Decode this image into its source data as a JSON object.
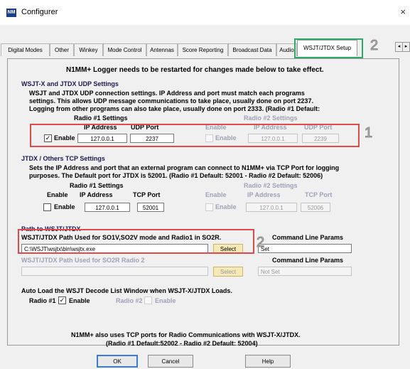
{
  "window": {
    "title": "Configurer",
    "icon": "n1mm-logo-icon",
    "icon_text": "NM",
    "close_glyph": "×"
  },
  "tabs": [
    {
      "label": "Digital Modes"
    },
    {
      "label": "Other"
    },
    {
      "label": "Winkey"
    },
    {
      "label": "Mode Control"
    },
    {
      "label": "Antennas"
    },
    {
      "label": "Score Reporting"
    },
    {
      "label": "Broadcast Data"
    },
    {
      "label": "Audio"
    },
    {
      "label": "WSJT/JTDX Setup",
      "active": true
    }
  ],
  "tab_scroll": {
    "left": "◂",
    "right": "▸"
  },
  "annotations": {
    "one": "1",
    "two": "2"
  },
  "panel": {
    "restart_notice": "N1MM+ Logger needs to be restarted for changes made below to take effect.",
    "udp": {
      "heading": "WSJT-X and JTDX UDP Settings",
      "description": [
        "WSJT and JTDX UDP connection settings. IP Address and port must match each programs",
        "settings. This allows UDP message communications to take place, usually done on port 2237.",
        "Logging from other programs can also take place, usually done on port 2333. (Radio #1 Default:"
      ],
      "radio1": {
        "title": "Radio #1 Settings",
        "enable_label": "Enable",
        "ip_label": "IP Address",
        "port_label": "UDP Port",
        "enabled": true,
        "ip": "127.0.0.1",
        "port": "2237"
      },
      "radio2": {
        "title": "Radio #2 Settings",
        "enable_col": "Enable",
        "enable_label": "Enable",
        "ip_label": "IP Address",
        "port_label": "UDP Port",
        "enabled": false,
        "ip": "127.0.0.1",
        "port": "2239"
      }
    },
    "tcp": {
      "heading": "JTDX / Others TCP Settings",
      "description": [
        "Sets the IP Address and port that an external program can connect to N1MM+ via TCP Port for logging",
        "purposes. The Default port for JTDX is 52001. (Radio #1 Default: 52001 - Radio #2 Default: 52006)"
      ],
      "radio1": {
        "title": "Radio #1 Settings",
        "enable_col": "Enable",
        "enable_label": "Enable",
        "ip_label": "IP Address",
        "port_label": "TCP Port",
        "enabled": false,
        "ip": "127.0.0.1",
        "port": "52001"
      },
      "radio2": {
        "title": "Radio #2 Settings",
        "enable_col": "Enable",
        "enable_label": "Enable",
        "ip_label": "IP Address",
        "port_label": "TCP Port",
        "enabled": false,
        "ip": "127.0.0.1",
        "port": "52006"
      }
    },
    "path": {
      "heading": "Path to WSJT/JTDX",
      "radio1_label": "WSJT/JTDX Path Used for SO1V,SO2V mode and Radio1 in SO2R.",
      "radio1_value": "C:\\WSJT\\wsjtx\\bin\\wsjtx.exe",
      "select_label": "Select",
      "cmd_label": "Command Line Params",
      "radio1_cmd": "Set",
      "radio2_label": "WSJT/JTDX Path Used for SO2R Radio 2",
      "radio2_value": "",
      "radio2_cmd": "Not Set"
    },
    "autoload": {
      "label": "Auto Load the WSJT Decode List Window when WSJT-X/JTDX Loads.",
      "radio1_label": "Radio #1",
      "radio1_enable": "Enable",
      "radio1_checked": true,
      "radio2_label": "Radio #2",
      "radio2_enable": "Enable",
      "radio2_checked": false
    },
    "footer_note": [
      "N1MM+ also uses TCP ports for Radio Communications with WSJT-X/JTDX.",
      "(Radio #1 Default:52002 - Radio #2 Default: 52004)"
    ]
  },
  "buttons": {
    "ok": "OK",
    "cancel": "Cancel",
    "help": "Help"
  },
  "check_glyph": "✓"
}
